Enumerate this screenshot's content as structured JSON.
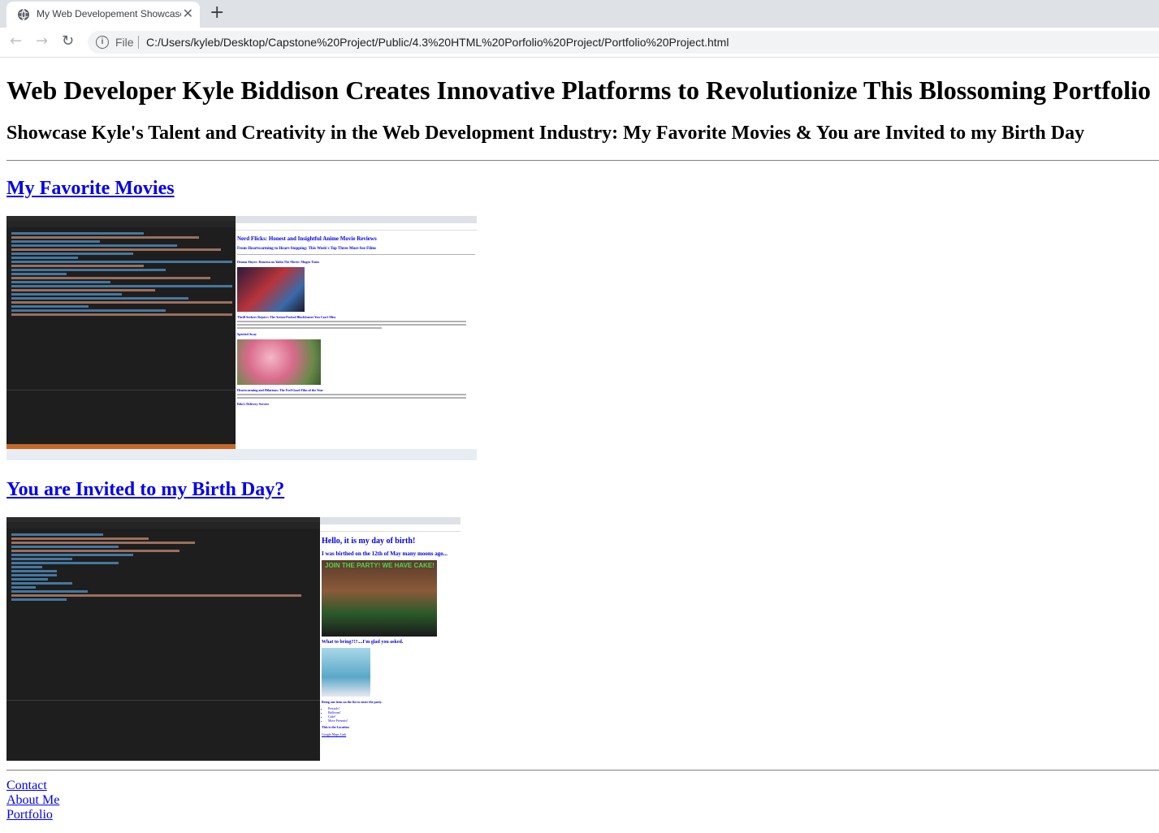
{
  "browser": {
    "tab_title": "My Web Developement Showcase",
    "close_glyph": "✕",
    "newtab_glyph": "+",
    "back_glyph": "←",
    "forward_glyph": "→",
    "reload_glyph": "↻",
    "info_glyph": "i",
    "file_label": "File",
    "url": "C:/Users/kyleb/Desktop/Capstone%20Project/Public/4.3%20HTML%20Porfolio%20Project/Portfolio%20Project.html"
  },
  "page": {
    "heading": "Web Developer Kyle Biddison Creates Innovative Platforms to Revolutionize This Blossoming Portfolio",
    "subheading": "Showcase Kyle's Talent and Creativity in the Web Development Industry: My Favorite Movies & You are Invited to my Birth Day",
    "section1_link": "My Favorite Movies",
    "section2_link": "You are Invited to my Birth Day?",
    "footer": {
      "contact": "Contact",
      "about": "About Me",
      "portfolio": "Portfolio"
    }
  },
  "shot1": {
    "title": "Nerd Flicks: Honest and Insightful Anime Movie Reviews",
    "subtitle": "From Heartwarming to Heart-Stopping: This Week's Top Three Must-See Films",
    "movie1": "Demon Slayer: Kimetsu no Yaiba The Movie: Mugen Train",
    "movie1_caption": "Thrill Seekers Rejoice: The Action-Packed Blockbuster You Can't Miss",
    "movie2": "Spirited Away",
    "movie2_caption": "Heartwarming and Hilarious: The Feel-Good Film of the Year",
    "movie3": "Kiki's Delivery Service"
  },
  "shot2": {
    "title": "Hello, it is my day of birth!",
    "subtitle": "I was birthed on the 12th of May many moons ago...",
    "banner": "JOIN THE PARTY! WE HAVE CAKE!",
    "bring": "What to bring?!?....I'm glad you asked.",
    "bring_one": "Bring one item on the list to enter the party.",
    "items": [
      "Pretzels!",
      "Balloons!",
      "Cake!",
      "More Presents!"
    ],
    "location": "This is the Location",
    "map_link": "Google Maps Link"
  },
  "colors": {
    "link": "#0000ee",
    "editor_bg": "#1e1e1e",
    "statusbar": "#c56a27"
  }
}
